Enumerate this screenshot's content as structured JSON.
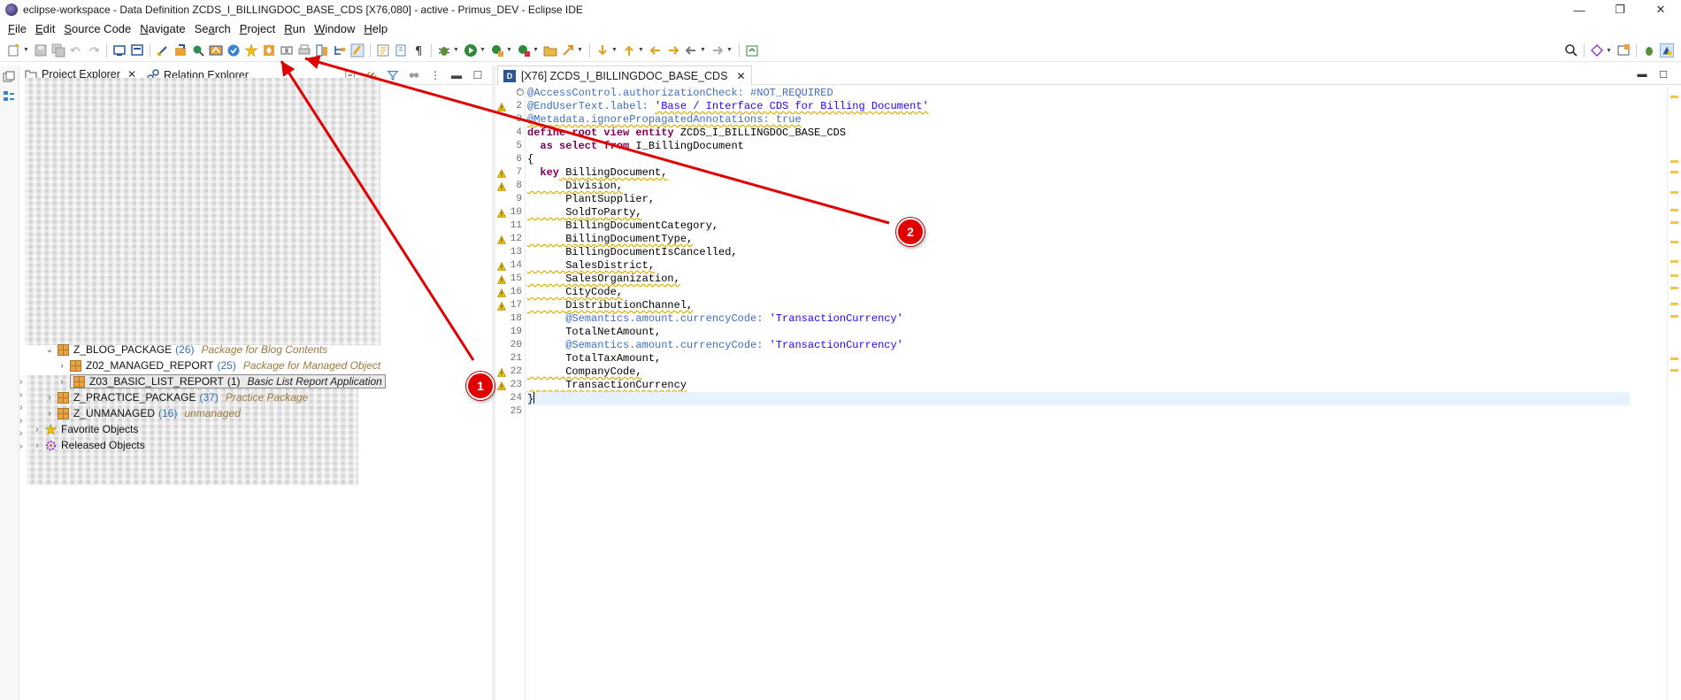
{
  "window": {
    "title": "eclipse-workspace - Data Definition ZCDS_I_BILLINGDOC_BASE_CDS [X76,080] - active - Primus_DEV - Eclipse IDE",
    "minimize": "—",
    "restore": "❐",
    "close": "✕"
  },
  "menu": [
    {
      "pre": "",
      "u": "F",
      "post": "ile"
    },
    {
      "pre": "",
      "u": "E",
      "post": "dit"
    },
    {
      "pre": "",
      "u": "S",
      "post": "ource Code"
    },
    {
      "pre": "",
      "u": "N",
      "post": "avigate"
    },
    {
      "pre": "Se",
      "u": "a",
      "post": "rch"
    },
    {
      "pre": "",
      "u": "P",
      "post": "roject"
    },
    {
      "pre": "",
      "u": "R",
      "post": "un"
    },
    {
      "pre": "",
      "u": "W",
      "post": "indow"
    },
    {
      "pre": "",
      "u": "H",
      "post": "elp"
    }
  ],
  "views": {
    "project_explorer": "Project Explorer",
    "relation_explorer": "Relation Explorer",
    "close": "✕"
  },
  "tree": [
    {
      "name": "Z_BLOG_PACKAGE",
      "count": "(26)",
      "desc": "Package for Blog Contents",
      "arrow": "⌄"
    },
    {
      "name": "Z02_MANAGED_REPORT",
      "count": "(25)",
      "desc": "Package for Managed Object",
      "arrow": "›"
    },
    {
      "name": "Z03_BASIC_LIST_REPORT",
      "count": "(1)",
      "desc": "Basic List Report Application",
      "arrow": "›"
    },
    {
      "name": "Z_PRACTICE_PACKAGE",
      "count": "(37)",
      "desc": "Practice Package",
      "arrow": "›"
    },
    {
      "name": "Z_UNMANAGED",
      "count": "(16)",
      "desc": "unmanaged",
      "arrow": "›"
    },
    {
      "name": "Favorite Objects",
      "arrow": "›"
    },
    {
      "name": "Released Objects",
      "arrow": "›"
    }
  ],
  "editor": {
    "tab_icon": "D",
    "tab_title": "[X76] ZCDS_I_BILLINGDOC_BASE_CDS",
    "tab_close": "✕"
  },
  "code": {
    "line_numbers": [
      "1",
      "2",
      "3",
      "4",
      "5",
      "6",
      "7",
      "8",
      "9",
      "10",
      "11",
      "12",
      "13",
      "14",
      "15",
      "16",
      "17",
      "18",
      "19",
      "20",
      "21",
      "22",
      "23",
      "24",
      "25"
    ],
    "l1": "@AccessControl.authorizationCheck: #NOT_REQUIRED",
    "l2a": "@EndUserText.label: ",
    "l2b": "'Base / Interface CDS for Billing Document'",
    "l3": "@Metadata.ignorePropagatedAnnotations: true",
    "l4a": "define root view entity",
    "l4b": " ZCDS_I_BILLINGDOC_BASE_CDS",
    "l5a": "  as select from",
    "l5b": " I_BillingDocument",
    "l6": "{",
    "l7a": "  key",
    "l7b": " BillingDocument,",
    "l8": "      Division,",
    "l9": "      PlantSupplier,",
    "l10": "      SoldToParty,",
    "l11": "      BillingDocumentCategory,",
    "l12": "      BillingDocumentType,",
    "l13": "      BillingDocumentIsCancelled,",
    "l14": "      SalesDistrict,",
    "l15": "      SalesOrganization,",
    "l16": "      CityCode,",
    "l17": "      DistributionChannel,",
    "l18a": "      @Semantics.amount.currencyCode: ",
    "l18b": "'TransactionCurrency'",
    "l19": "      TotalNetAmount,",
    "l20a": "      @Semantics.amount.currencyCode: ",
    "l20b": "'TransactionCurrency'",
    "l21": "      TotalTaxAmount,",
    "l22": "      CompanyCode,",
    "l23": "      TransactionCurrency",
    "l24": "}"
  },
  "annotations": {
    "badge1": "1",
    "badge2": "2",
    "color": "#e00000"
  }
}
